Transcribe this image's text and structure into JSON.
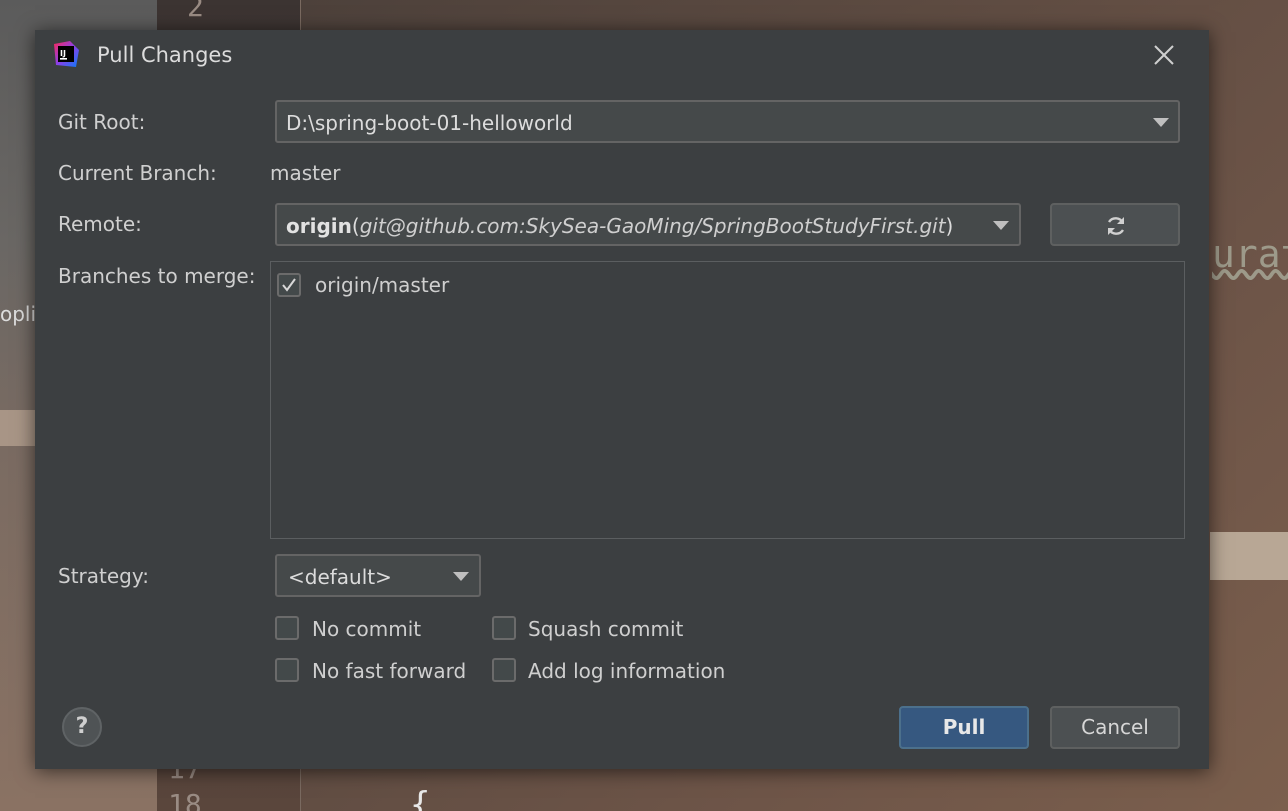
{
  "background": {
    "line_numbers": [
      "2",
      "17",
      "18"
    ],
    "left_panel_fragment": "opli",
    "right_code_fragment": "urati",
    "code_fragment": "{"
  },
  "dialog": {
    "title": "Pull Changes",
    "app_icon": "intellij-idea-icon",
    "git_root": {
      "label": "Git Root:",
      "value": "D:\\spring-boot-01-helloworld"
    },
    "current_branch": {
      "label": "Current Branch:",
      "value": "master"
    },
    "remote": {
      "label": "Remote:",
      "name": "origin",
      "url": "git@github.com:SkySea-GaoMing/SpringBootStudyFirst.git",
      "open_paren": "(",
      "close_paren": ")",
      "refresh_icon": "refresh-icon"
    },
    "branches": {
      "label": "Branches to merge:",
      "items": [
        {
          "name": "origin/master",
          "checked": true
        }
      ]
    },
    "strategy": {
      "label": "Strategy:",
      "value": "<default>"
    },
    "options": {
      "no_commit": {
        "label": "No commit",
        "checked": false
      },
      "squash_commit": {
        "label": "Squash commit",
        "checked": false
      },
      "no_fast_forward": {
        "label": "No fast forward",
        "checked": false
      },
      "add_log_information": {
        "label": "Add log information",
        "checked": false
      }
    },
    "help_label": "?",
    "pull_label": "Pull",
    "cancel_label": "Cancel"
  },
  "colors": {
    "dialog_bg": "#3c3f41",
    "primary_button": "#365880",
    "text": "#cfcfcf"
  }
}
